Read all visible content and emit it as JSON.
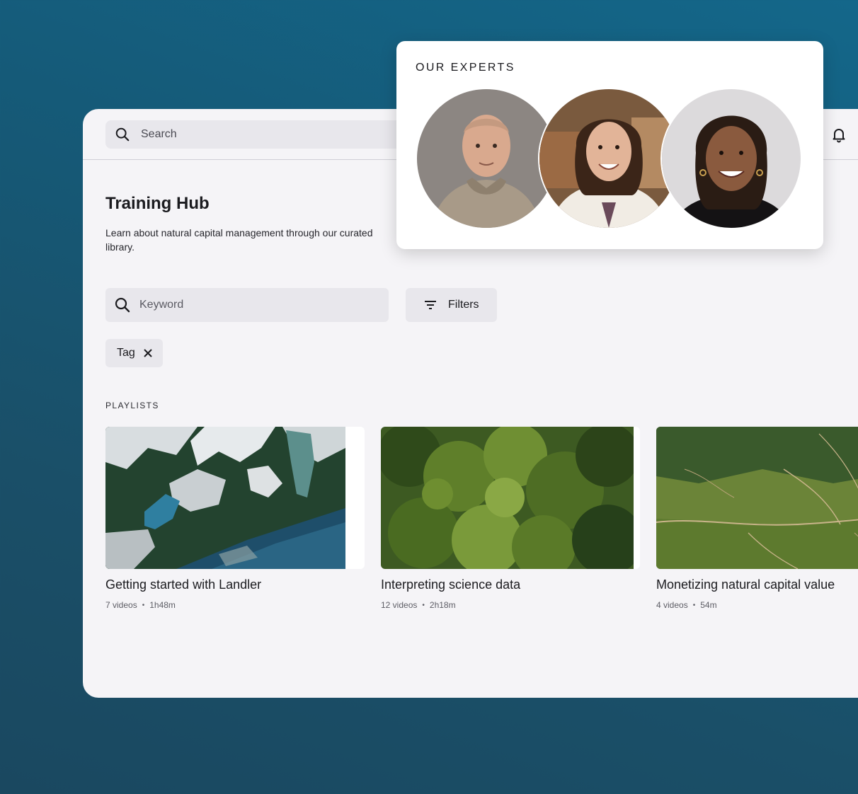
{
  "topbar": {
    "search_placeholder": "Search"
  },
  "page": {
    "title": "Training Hub",
    "subtitle": "Learn about natural capital management through our curated library."
  },
  "filters": {
    "keyword_placeholder": "Keyword",
    "filters_label": "Filters",
    "tag_label": "Tag"
  },
  "playlists": {
    "section_label": "PLAYLISTS",
    "items": [
      {
        "title": "Getting started with Landler",
        "videos": "7 videos",
        "duration": "1h48m"
      },
      {
        "title": "Interpreting science data",
        "videos": "12 videos",
        "duration": "2h18m"
      },
      {
        "title": "Monetizing natural capital value",
        "videos": "4 videos",
        "duration": "54m"
      }
    ],
    "separator": "•"
  },
  "experts": {
    "title": "OUR EXPERTS"
  },
  "colors": {
    "background": "#155a78",
    "panel": "#f5f4f7",
    "input": "#e8e7ec",
    "card": "#ffffff"
  },
  "icons": [
    "search-icon",
    "bell-icon",
    "filter-icon",
    "close-icon"
  ]
}
